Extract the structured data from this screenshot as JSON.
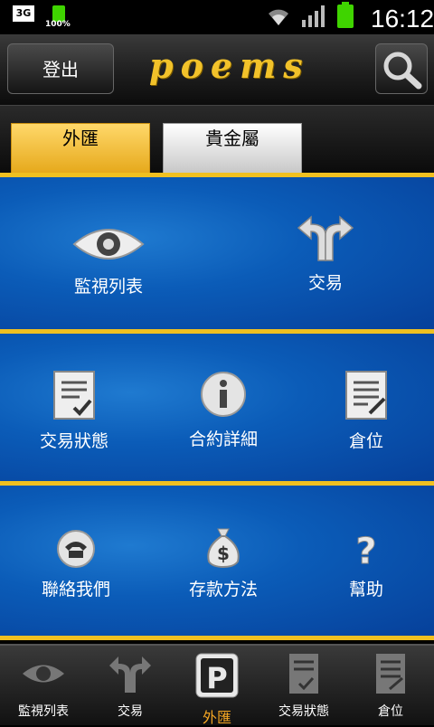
{
  "status_bar": {
    "network": "3G",
    "battery_small_percent": "100%",
    "time": "16:12"
  },
  "header": {
    "logout_label": "登出",
    "logo_text": "poems",
    "search_icon": "search-icon"
  },
  "tabs": [
    {
      "label": "外匯",
      "active": true
    },
    {
      "label": "貴金屬",
      "active": false
    }
  ],
  "grid": {
    "row1": [
      {
        "label": "監視列表",
        "icon": "eye-icon"
      },
      {
        "label": "交易",
        "icon": "trade-arrows-icon"
      }
    ],
    "row2": [
      {
        "label": "交易狀態",
        "icon": "document-check-icon"
      },
      {
        "label": "合約詳細",
        "icon": "info-icon"
      },
      {
        "label": "倉位",
        "icon": "document-edit-icon"
      }
    ],
    "row3": [
      {
        "label": "聯絡我們",
        "icon": "phone-icon"
      },
      {
        "label": "存款方法",
        "icon": "money-bag-icon"
      },
      {
        "label": "幫助",
        "icon": "question-icon"
      }
    ]
  },
  "bottom_nav": [
    {
      "label": "監視列表",
      "icon": "eye-icon"
    },
    {
      "label": "交易",
      "icon": "trade-arrows-icon"
    },
    {
      "label": "外匯",
      "icon": "p-logo-icon",
      "active": true
    },
    {
      "label": "交易狀態",
      "icon": "document-check-icon"
    },
    {
      "label": "倉位",
      "icon": "document-edit-icon"
    }
  ],
  "colors": {
    "accent_gold": "#f0c020",
    "panel_blue": "#0b5cb8",
    "active_nav": "#f5a623"
  }
}
